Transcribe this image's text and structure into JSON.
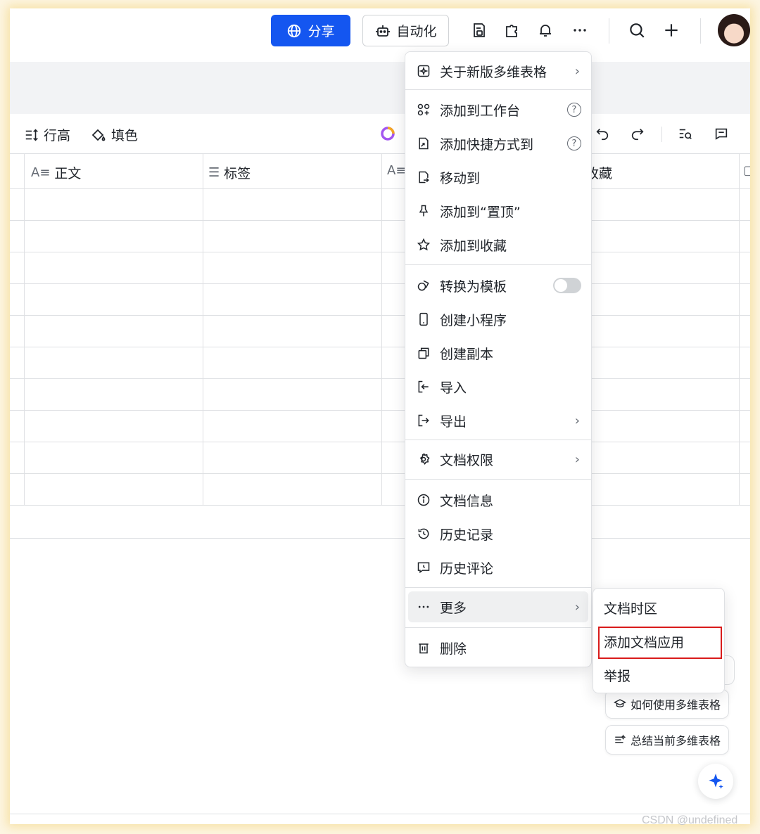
{
  "header": {
    "share_label": "分享",
    "automation_label": "自动化"
  },
  "toolbar": {
    "row_height_label": "行高",
    "fill_color_label": "填色"
  },
  "columns": [
    {
      "label": "正文"
    },
    {
      "label": "标签"
    },
    {
      "label": "收藏"
    }
  ],
  "menu": {
    "items": [
      {
        "label": "关于新版多维表格",
        "icon": "sparkle-frame-icon",
        "has_arrow": true
      },
      {
        "label": "添加到工作台",
        "icon": "workspace-grid-icon",
        "has_help": true
      },
      {
        "label": "添加快捷方式到",
        "icon": "shortcut-icon",
        "has_help": true
      },
      {
        "label": "移动到",
        "icon": "move-doc-icon"
      },
      {
        "label": "添加到“置顶”",
        "icon": "pin-icon"
      },
      {
        "label": "添加到收藏",
        "icon": "star-icon"
      },
      {
        "label": "转换为模板",
        "icon": "template-icon",
        "toggle": false
      },
      {
        "label": "创建小程序",
        "icon": "mini-program-icon"
      },
      {
        "label": "创建副本",
        "icon": "copy-icon"
      },
      {
        "label": "导入",
        "icon": "import-icon"
      },
      {
        "label": "导出",
        "icon": "export-icon",
        "has_arrow": true
      },
      {
        "label": "文档权限",
        "icon": "gear-icon",
        "has_arrow": true
      },
      {
        "label": "文档信息",
        "icon": "info-icon"
      },
      {
        "label": "历史记录",
        "icon": "history-icon"
      },
      {
        "label": "历史评论",
        "icon": "comment-history-icon"
      },
      {
        "label": "更多",
        "icon": "more-dots-icon",
        "has_arrow": true
      },
      {
        "label": "删除",
        "icon": "trash-icon"
      }
    ]
  },
  "submenu": {
    "items": [
      {
        "label": "文档时区"
      },
      {
        "label": "添加文档应用"
      },
      {
        "label": "举报"
      }
    ]
  },
  "ai_suggestions": [
    {
      "label": "如何使用多维表格"
    },
    {
      "label": "总结当前多维表格"
    }
  ],
  "watermark": "CSDN @undefined",
  "colors": {
    "primary": "#1456f0",
    "highlight_border": "#d91b1b",
    "hover_bg": "#eff0f1"
  }
}
